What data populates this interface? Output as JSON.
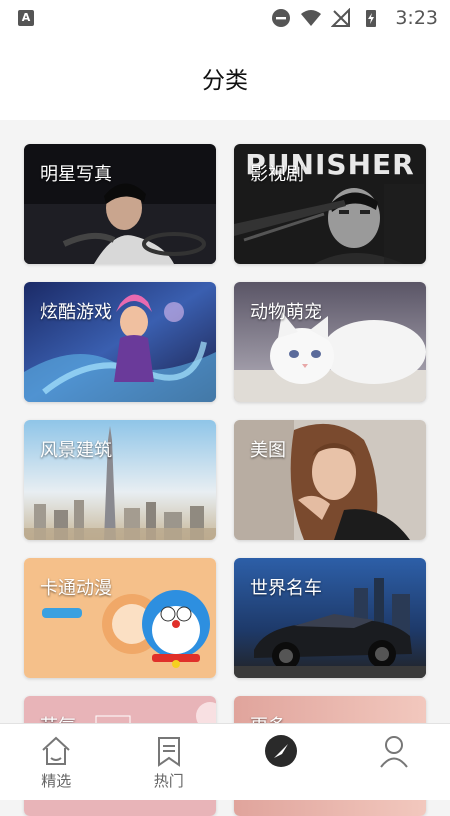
{
  "status": {
    "time": "3:23"
  },
  "header": {
    "title": "分类"
  },
  "categories": [
    {
      "label": "明星写真"
    },
    {
      "label": "影视剧"
    },
    {
      "label": "炫酷游戏"
    },
    {
      "label": "动物萌宠"
    },
    {
      "label": "风景建筑"
    },
    {
      "label": "美图"
    },
    {
      "label": "卡通动漫"
    },
    {
      "label": "世界名车"
    },
    {
      "label": "节气"
    },
    {
      "label": "更多"
    }
  ],
  "poster_text": "PUNISHER",
  "nav": [
    {
      "label": "精选"
    },
    {
      "label": "热门"
    },
    {
      "label": ""
    },
    {
      "label": ""
    }
  ]
}
